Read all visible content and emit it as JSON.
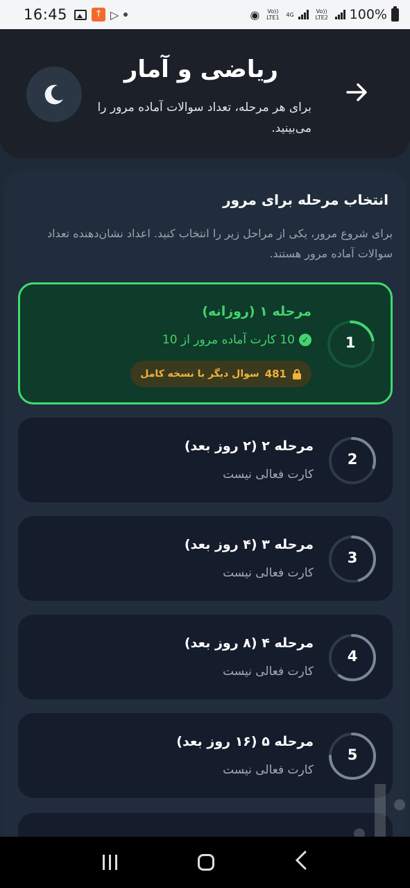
{
  "status_bar": {
    "time": "16:45",
    "net_1": "Vo)) LTE1",
    "net_4g": "4G",
    "net_2": "Vo)) LTE2",
    "battery": "100%"
  },
  "header": {
    "title": "ریاضی و آمار",
    "subtitle": "برای هر مرحله، تعداد سوالات آماده مرور را می‌بینید.",
    "back_icon": "arrow-right-icon",
    "theme_icon": "moon-icon"
  },
  "section": {
    "title": "انتخاب مرحله برای مرور",
    "description": "برای شروع مرور، یکی از مراحل زیر را انتخاب کنید. اعداد نشان‌دهنده تعداد سوالات آماده مرور هستند."
  },
  "stages": [
    {
      "number": "1",
      "title": "مرحله ۱ (روزانه)",
      "status": "10 کارت آماده مرور از 10",
      "locked_count": "481",
      "locked_text": "سوال دیگر با نسخه کامل",
      "progress": 0.22,
      "active": true
    },
    {
      "number": "2",
      "title": "مرحله ۲ (۲ روز بعد)",
      "status": "کارت فعالی نیست",
      "progress": 0.3,
      "active": false
    },
    {
      "number": "3",
      "title": "مرحله ۳ (۴ روز بعد)",
      "status": "کارت فعالی نیست",
      "progress": 0.45,
      "active": false
    },
    {
      "number": "4",
      "title": "مرحله ۴ (۸ روز بعد)",
      "status": "کارت فعالی نیست",
      "progress": 0.6,
      "active": false
    },
    {
      "number": "5",
      "title": "مرحله ۵ (۱۶ روز بعد)",
      "status": "کارت فعالی نیست",
      "progress": 0.75,
      "active": false
    }
  ],
  "colors": {
    "accent_green": "#44d36f",
    "lock_amber": "#f0b23a",
    "ring_track": "#2f3a4b",
    "ring_fill": "#7b8696"
  }
}
